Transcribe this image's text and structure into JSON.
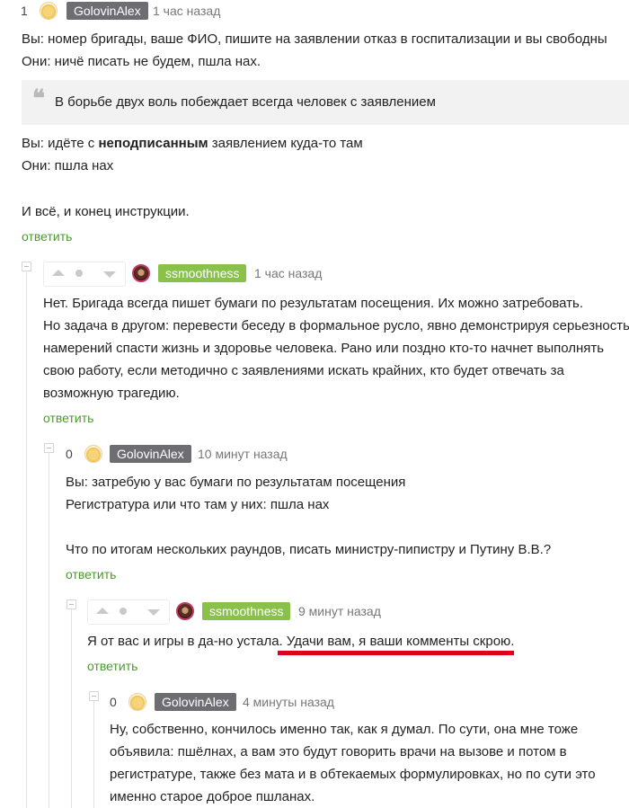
{
  "comments": [
    {
      "rating": "1",
      "username": "GolovinAlex",
      "time": "1 час назад",
      "lines": [
        "Вы: номер бригады, ваше ФИО, пишите на заявлении отказ в госпитализации и вы свободны",
        "Они: ничё писать не будем, пшла нах."
      ],
      "quote": "В борьбе двух воль побеждает всегда человек с заявлением",
      "lines2": {
        "prefix": "Вы: идёте с ",
        "bold": "неподписанным",
        "suffix": " заявлением куда-то там"
      },
      "lines3": [
        "Они: пшла нах",
        "И всё, и конец инструкции."
      ],
      "reply": "ответить"
    },
    {
      "username": "ssmoothness",
      "time": "1 час назад",
      "lines": [
        "Нет. Бригада всегда пишет бумаги по результатам посещения. Их можно затребовать.",
        "Но задача в другом: перевести беседу в формальное русло, явно демонстрируя серьезность",
        "намерений спасти жизнь и здоровье человека. Рано или поздно кто-то начнет выполнять",
        "свою работу, если методично с заявлениями искать крайних, кто будет отвечать за",
        "возможную трагедию."
      ],
      "reply": "ответить"
    },
    {
      "rating": "0",
      "username": "GolovinAlex",
      "time": "10 минут назад",
      "lines": [
        "Вы: затребую у вас бумаги по результатам посещения",
        "Регистратура или что там у них: пшла нах",
        "Что по итогам нескольких раундов, писать министру-пипистру и Путину В.В.?"
      ],
      "reply": "ответить"
    },
    {
      "username": "ssmoothness",
      "time": "9 минут назад",
      "text_plain": "Я от вас и игры в да-но устала. ",
      "text_marked": "Удачи вам, я ваши комменты скрою.",
      "reply": "ответить"
    },
    {
      "rating": "0",
      "username": "GolovinAlex",
      "time": "4 минуты назад",
      "lines": [
        "Ну, собственно, кончилось именно так, как я думал. По сути, она мне тоже",
        "объявила: пшёлнах, а вам это будут говорить врачи на вызове и потом в",
        "регистратуре, также без мата и в обтекаемых формулировках, но по сути это",
        "именно старое доброе пшланах."
      ]
    }
  ],
  "colors": {
    "reply_link": "#4b9a2e",
    "gray_badge": "#6e6e72",
    "green_badge": "#8ac14a",
    "underline_mark": "#e0001b"
  }
}
